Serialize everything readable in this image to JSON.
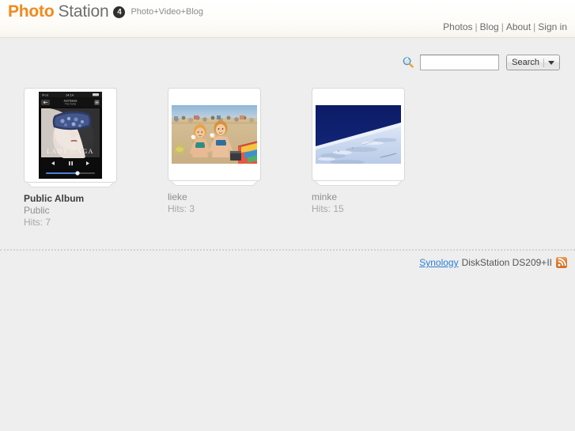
{
  "header": {
    "logo_primary": "Photo",
    "logo_secondary": "Station",
    "logo_badge": "4",
    "tagline": "Photo+Video+Blog"
  },
  "topnav": {
    "items": [
      {
        "label": "Photos",
        "name": "nav-photos"
      },
      {
        "label": "Blog",
        "name": "nav-blog"
      },
      {
        "label": "About",
        "name": "nav-about"
      },
      {
        "label": "Sign in",
        "name": "nav-sign-in"
      }
    ],
    "separator": "|"
  },
  "search": {
    "icon": "magnifier-icon",
    "value": "",
    "placeholder": "",
    "button_label": "Search",
    "dropdown_icon": "caret-down-icon"
  },
  "albums": [
    {
      "title": "Public Album",
      "description": "Public",
      "hits": "Hits: 7",
      "owned": true,
      "thumb": "lady-gaga-ipod-player-screenshot"
    },
    {
      "title": "lieke",
      "description": "",
      "hits": "Hits: 3",
      "owned": false,
      "thumb": "two-girls-on-beach-with-ice-cream"
    },
    {
      "title": "minke",
      "description": "",
      "hits": "Hits: 15",
      "owned": false,
      "thumb": "snowy-slope-under-blue-sky"
    }
  ],
  "footer": {
    "brand": "Synology",
    "model": "DiskStation DS209+II",
    "rss_icon": "rss-feed-icon"
  },
  "colors": {
    "logo_orange": "#f08a1c",
    "logo_gray": "#6f6f6f",
    "link_blue": "#2b7fd4",
    "rss_orange": "#ee7b22",
    "page_bg": "#eeeeee"
  }
}
